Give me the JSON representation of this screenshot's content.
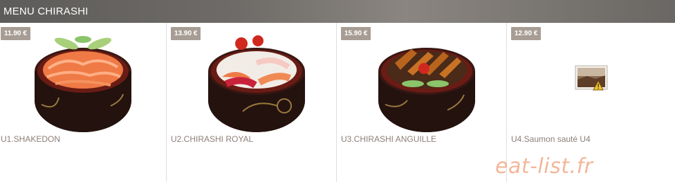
{
  "header": {
    "title": "MENU CHIRASHI"
  },
  "items": [
    {
      "price": "11.90 €",
      "name": "U1.SHAKEDON",
      "image": "salmon-bowl"
    },
    {
      "price": "13.90 €",
      "name": "U2.CHIRASHI ROYAL",
      "image": "mixed-fish-bowl"
    },
    {
      "price": "15.90 €",
      "name": "U3.CHIRASHI ANGUILLE",
      "image": "eel-bowl"
    },
    {
      "price": "12.90 €",
      "name": "U4.Saumon sauté U4",
      "image": "broken-image-icon"
    }
  ],
  "watermark": "eat-list.fr",
  "colors": {
    "price_badge": "#a79d94",
    "item_name": "#8d7f78",
    "watermark": "#f3b79a",
    "bowl": "#2a1512"
  }
}
